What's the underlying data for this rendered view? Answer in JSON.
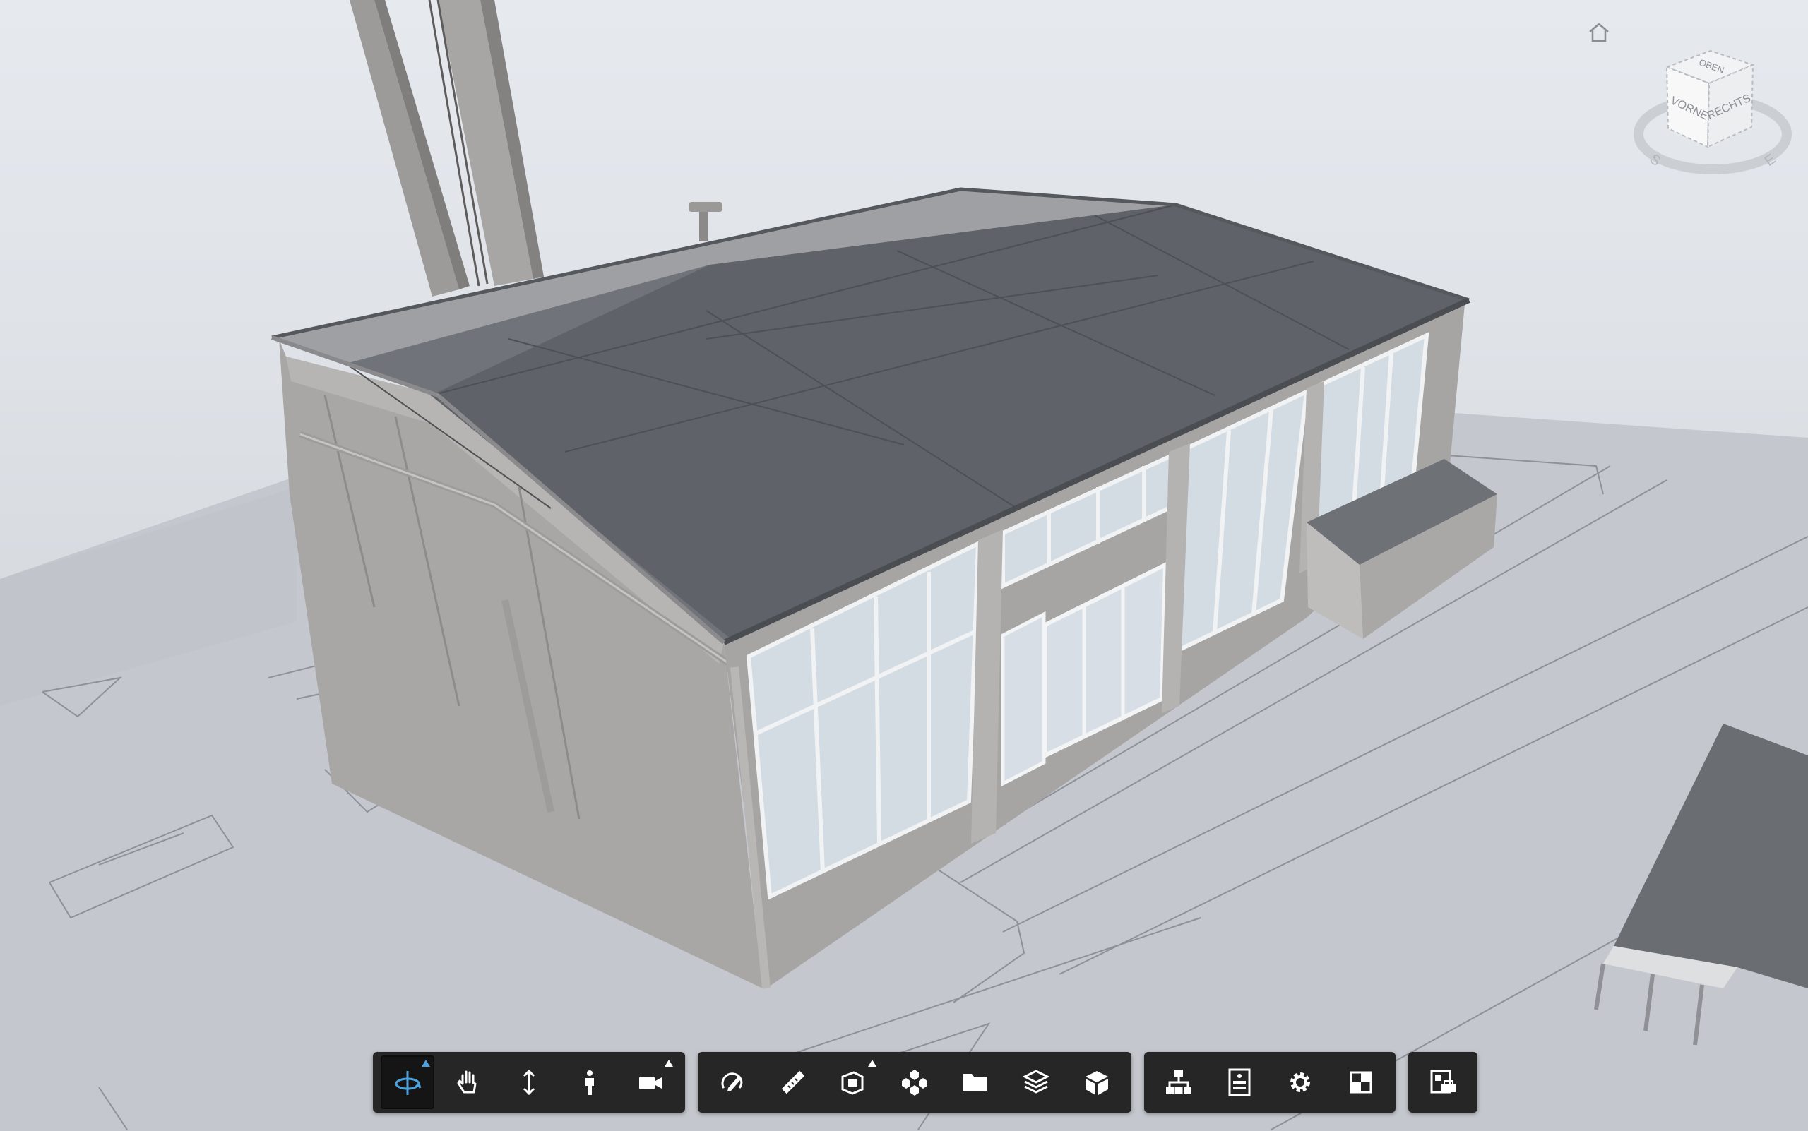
{
  "viewcube": {
    "face_top": "OBEN",
    "face_front": "VORNE",
    "face_right": "RECHTS",
    "compass_s": "S",
    "compass_e": "E"
  },
  "colors": {
    "toolbar_bg": "#262626",
    "icon": "#ffffff",
    "active_icon": "#4aa3df",
    "roof": "#6b6e74",
    "wall": "#a9a8a6",
    "ground": "#c6c9cf"
  },
  "toolbar": {
    "navigation": [
      {
        "icon": "orbit-icon",
        "active": true,
        "flyout": true
      },
      {
        "icon": "pan-icon",
        "active": false,
        "flyout": false
      },
      {
        "icon": "zoom-icon",
        "active": false,
        "flyout": false
      },
      {
        "icon": "first-person-icon",
        "active": false,
        "flyout": false
      },
      {
        "icon": "camera-icon",
        "active": false,
        "flyout": true
      }
    ],
    "review": [
      {
        "icon": "markup-icon",
        "flyout": false
      },
      {
        "icon": "measure-icon",
        "flyout": false
      },
      {
        "icon": "section-icon",
        "flyout": true
      },
      {
        "icon": "explode-icon",
        "flyout": false
      },
      {
        "icon": "folder-icon",
        "flyout": false
      },
      {
        "icon": "layers-icon",
        "flyout": false
      },
      {
        "icon": "model-icon",
        "flyout": false
      }
    ],
    "settings": [
      {
        "icon": "structure-icon",
        "flyout": false
      },
      {
        "icon": "properties-icon",
        "flyout": false
      },
      {
        "icon": "settings-icon",
        "flyout": false
      },
      {
        "icon": "fullscreen-icon",
        "flyout": false
      }
    ],
    "extra": [
      {
        "icon": "print-icon",
        "flyout": false
      }
    ]
  }
}
